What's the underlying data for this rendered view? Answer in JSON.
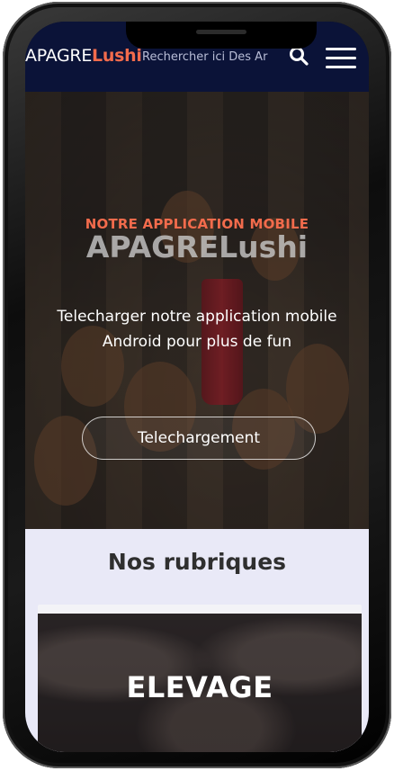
{
  "header": {
    "logo_part1": "APAGRE",
    "logo_part2": "Lushi",
    "search_placeholder": "Rechercher ici Des Ar",
    "search_icon": "search-icon",
    "menu_icon": "hamburger-menu-icon"
  },
  "hero": {
    "kicker": "NOTRE APPLICATION MOBILE",
    "title": "APAGRELushi",
    "text": "Telecharger notre application mobile Android pour plus de fun",
    "button_label": "Telechargement"
  },
  "rubriques": {
    "title": "Nos rubriques",
    "cards": [
      {
        "title": "ELEVAGE"
      }
    ]
  },
  "colors": {
    "accent": "#f26b4c",
    "header_bg": "#0b1338",
    "section_bg": "#e9e9f7"
  }
}
